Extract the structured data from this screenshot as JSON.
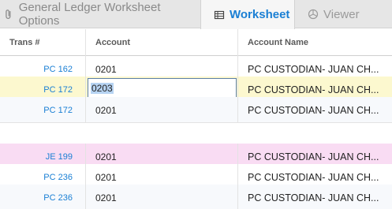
{
  "tabs": [
    {
      "label": "General Ledger Worksheet Options",
      "icon": "paperclip-icon",
      "active": false
    },
    {
      "label": "Worksheet",
      "icon": "table-icon",
      "active": true
    },
    {
      "label": "Viewer",
      "icon": "pie-chart-icon",
      "active": false
    }
  ],
  "columns": {
    "trans": "Trans #",
    "account": "Account",
    "name": "Account Name"
  },
  "rows": [
    {
      "trans": "PC 162",
      "account": "0201",
      "name": "PC CUSTODIAN- JUAN CH..."
    },
    {
      "trans": "PC 172",
      "account": "0203",
      "name": "PC CUSTODIAN- JUAN CH..."
    },
    {
      "trans": "PC 172",
      "account": "0201",
      "name": "PC CUSTODIAN- JUAN CH..."
    },
    {
      "trans": "JE 199",
      "account": "0201",
      "name": "PC CUSTODIAN- JUAN CH..."
    },
    {
      "trans": "PC 236",
      "account": "0201",
      "name": "PC CUSTODIAN- JUAN CH..."
    },
    {
      "trans": "PC 236",
      "account": "0201",
      "name": "PC CUSTODIAN- JUAN CH..."
    }
  ],
  "colors": {
    "accent": "#1a7fd4",
    "selected_row": "#fcf8cf",
    "highlight_row": "#f9dcf3"
  }
}
